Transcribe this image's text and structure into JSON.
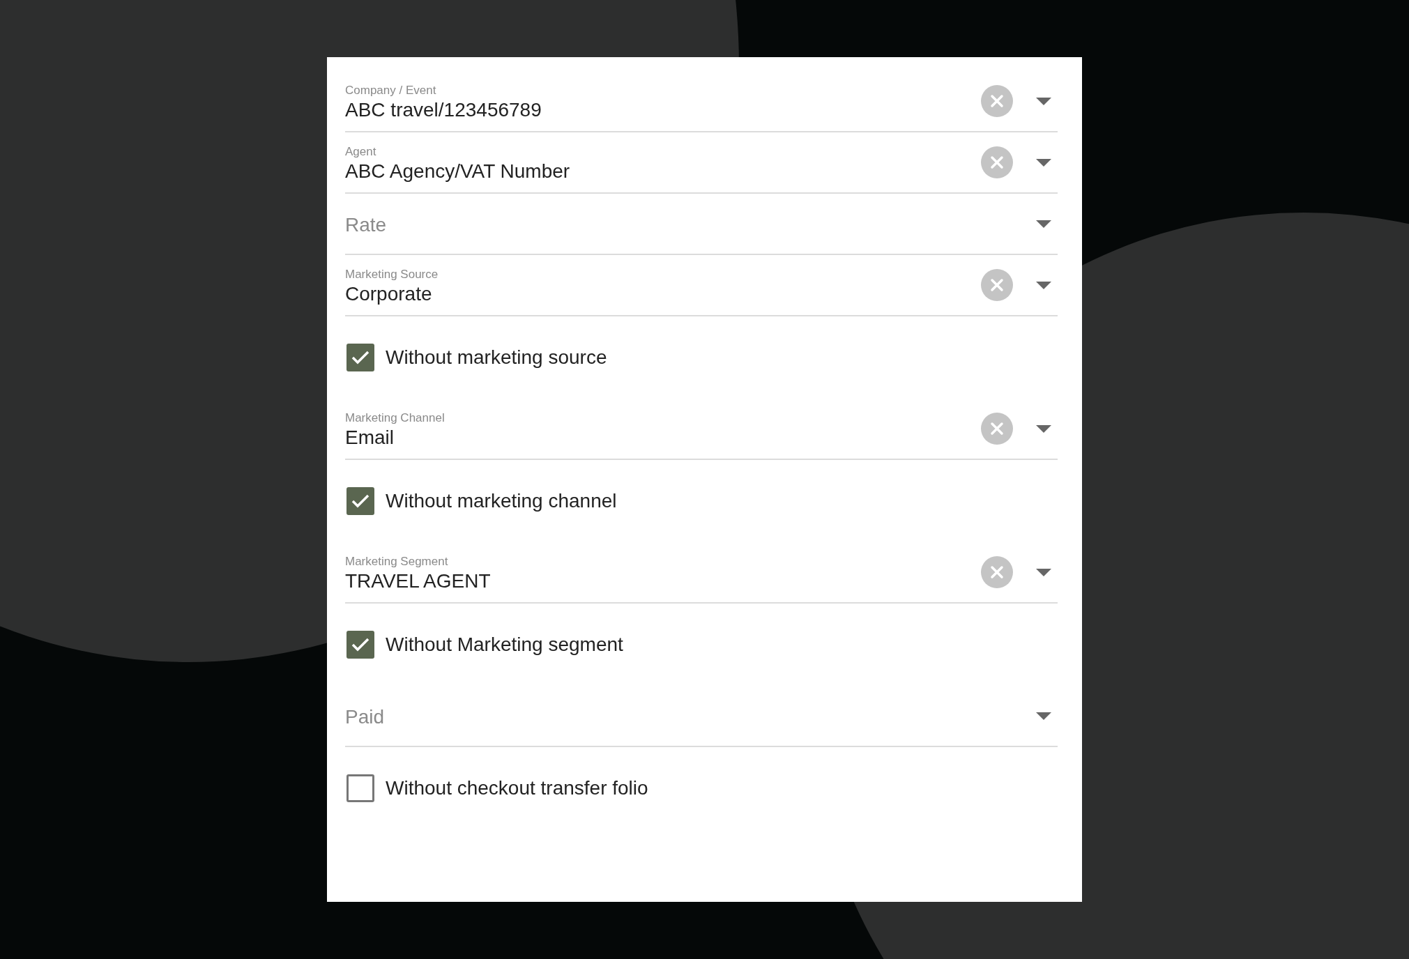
{
  "form": {
    "items": [
      {
        "kind": "select",
        "label": "Company / Event",
        "value": "ABC travel/123456789"
      },
      {
        "kind": "select",
        "label": "Agent",
        "value": "ABC Agency/VAT Number"
      },
      {
        "kind": "select",
        "placeholder": "Rate"
      },
      {
        "kind": "select",
        "label": "Marketing Source",
        "value": "Corporate"
      },
      {
        "kind": "checkbox",
        "label": "Without marketing source",
        "checked": true
      },
      {
        "kind": "select",
        "label": "Marketing Channel",
        "value": "Email"
      },
      {
        "kind": "checkbox",
        "label": "Without marketing channel",
        "checked": true
      },
      {
        "kind": "select",
        "label": "Marketing Segment",
        "value": "TRAVEL AGENT"
      },
      {
        "kind": "checkbox",
        "label": "Without Marketing segment",
        "checked": true
      },
      {
        "kind": "select",
        "placeholder": "Paid"
      },
      {
        "kind": "checkbox",
        "label": "Without checkout transfer folio",
        "checked": false
      }
    ]
  }
}
